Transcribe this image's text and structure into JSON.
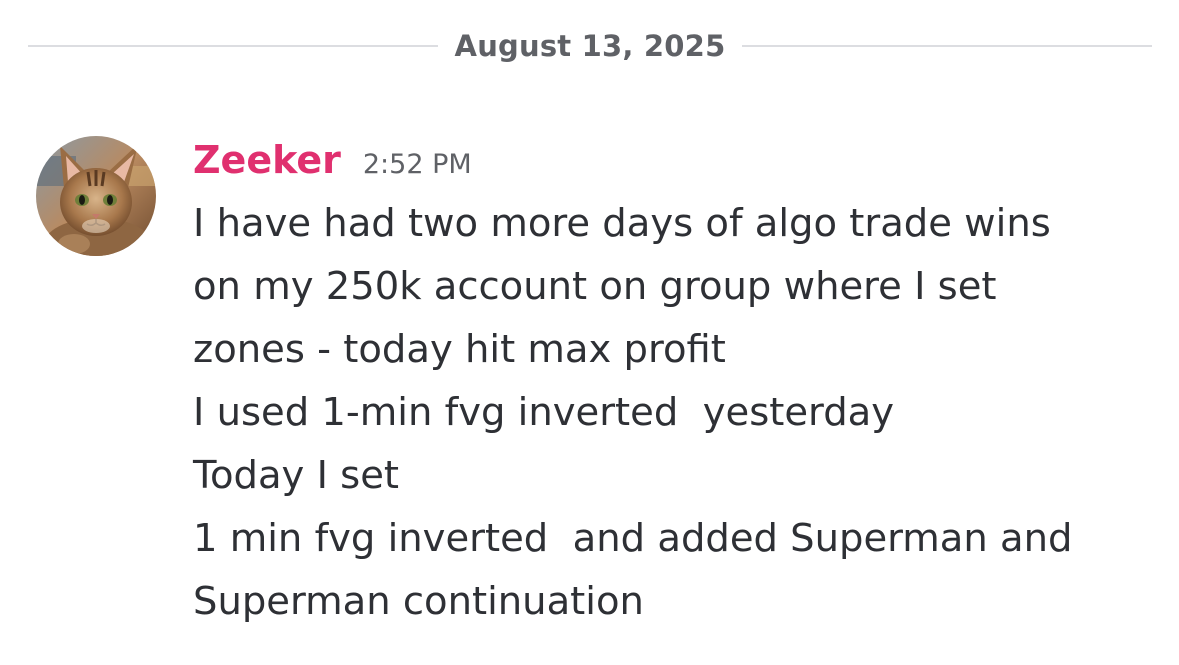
{
  "divider": {
    "date": "August 13, 2025"
  },
  "message": {
    "author": "Zeeker",
    "time": "2:52 PM",
    "avatar_icon": "cat-avatar-icon",
    "author_color": "#e0306f",
    "lines": [
      "I have had two more days of algo trade wins",
      "on my 250k account on group where I set",
      "zones - today hit max profit",
      "I used 1-min fvg inverted  yesterday",
      "Today I set",
      "1 min fvg inverted  and added Superman and",
      "Superman continuation"
    ]
  }
}
